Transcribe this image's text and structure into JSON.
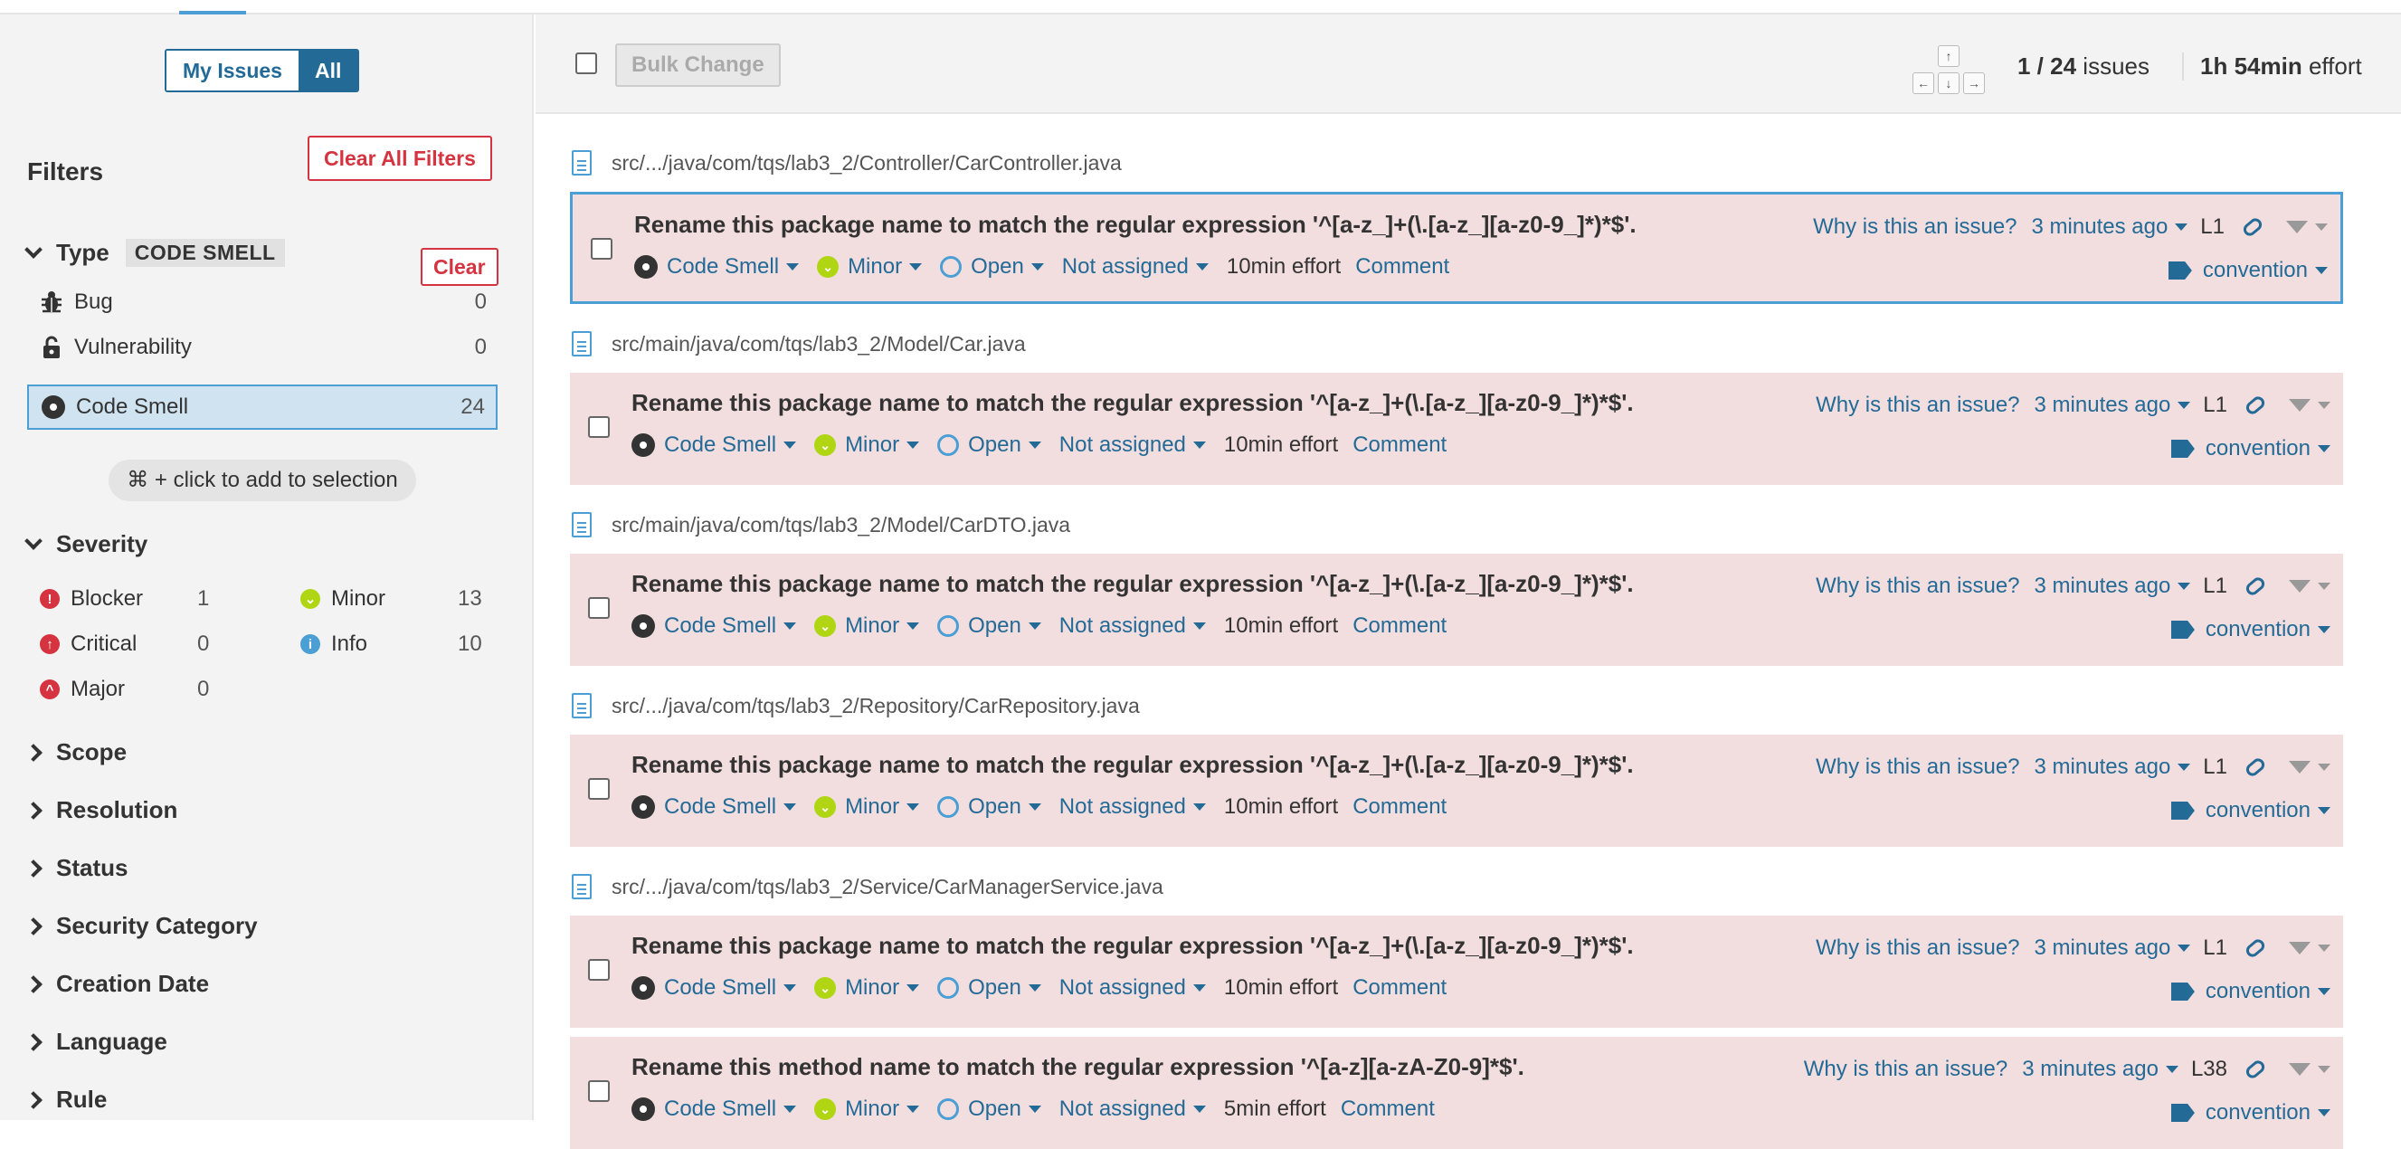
{
  "sidebar": {
    "mode_buttons": [
      "My Issues",
      "All"
    ],
    "filters_title": "Filters",
    "clear_all_label": "Clear All Filters",
    "type_facet": {
      "label": "Type",
      "value": "CODE SMELL",
      "clear_label": "Clear",
      "items": [
        {
          "label": "Bug",
          "count": "0",
          "icon": "bug-icon"
        },
        {
          "label": "Vulnerability",
          "count": "0",
          "icon": "lock-icon"
        },
        {
          "label": "Code Smell",
          "count": "24",
          "icon": "code-smell-icon",
          "selected": true
        }
      ]
    },
    "selection_hint": "⌘ + click to add to selection",
    "severity_facet": {
      "label": "Severity",
      "items": [
        {
          "label": "Blocker",
          "count": "1",
          "icon": "blocker-icon",
          "color": "#d4333f"
        },
        {
          "label": "Minor",
          "count": "13",
          "icon": "minor-icon",
          "color": "#b0d513"
        },
        {
          "label": "Critical",
          "count": "0",
          "icon": "critical-icon",
          "color": "#d4333f"
        },
        {
          "label": "Info",
          "count": "10",
          "icon": "info-icon",
          "color": "#4b9fd5"
        },
        {
          "label": "Major",
          "count": "0",
          "icon": "major-icon",
          "color": "#d4333f"
        }
      ]
    },
    "collapsed_facets": [
      "Scope",
      "Resolution",
      "Status",
      "Security Category",
      "Creation Date",
      "Language",
      "Rule"
    ]
  },
  "toolbar": {
    "bulk_change_label": "Bulk Change",
    "counter_current": "1 / 24",
    "counter_suffix": "issues",
    "effort_value": "1h 54min",
    "effort_suffix": "effort",
    "arrow_keys": [
      "↑",
      "←",
      "↓",
      "→"
    ]
  },
  "issues": [
    {
      "file": "src/.../java/com/tqs/lab3_2/Controller/CarController.java",
      "message": "Rename this package name to match the regular expression '^[a-z_]+(\\.[a-z_][a-z0-9_]*)*$'.",
      "type": "Code Smell",
      "severity": "Minor",
      "status": "Open",
      "assignee": "Not assigned",
      "effort": "10min effort",
      "comment": "Comment",
      "why": "Why is this an issue?",
      "time": "3 minutes ago",
      "line": "L1",
      "tag": "convention",
      "selected": true
    },
    {
      "file": "src/main/java/com/tqs/lab3_2/Model/Car.java",
      "message": "Rename this package name to match the regular expression '^[a-z_]+(\\.[a-z_][a-z0-9_]*)*$'.",
      "type": "Code Smell",
      "severity": "Minor",
      "status": "Open",
      "assignee": "Not assigned",
      "effort": "10min effort",
      "comment": "Comment",
      "why": "Why is this an issue?",
      "time": "3 minutes ago",
      "line": "L1",
      "tag": "convention"
    },
    {
      "file": "src/main/java/com/tqs/lab3_2/Model/CarDTO.java",
      "message": "Rename this package name to match the regular expression '^[a-z_]+(\\.[a-z_][a-z0-9_]*)*$'.",
      "type": "Code Smell",
      "severity": "Minor",
      "status": "Open",
      "assignee": "Not assigned",
      "effort": "10min effort",
      "comment": "Comment",
      "why": "Why is this an issue?",
      "time": "3 minutes ago",
      "line": "L1",
      "tag": "convention"
    },
    {
      "file": "src/.../java/com/tqs/lab3_2/Repository/CarRepository.java",
      "message": "Rename this package name to match the regular expression '^[a-z_]+(\\.[a-z_][a-z0-9_]*)*$'.",
      "type": "Code Smell",
      "severity": "Minor",
      "status": "Open",
      "assignee": "Not assigned",
      "effort": "10min effort",
      "comment": "Comment",
      "why": "Why is this an issue?",
      "time": "3 minutes ago",
      "line": "L1",
      "tag": "convention"
    },
    {
      "file": "src/.../java/com/tqs/lab3_2/Service/CarManagerService.java",
      "message": "Rename this package name to match the regular expression '^[a-z_]+(\\.[a-z_][a-z0-9_]*)*$'.",
      "type": "Code Smell",
      "severity": "Minor",
      "status": "Open",
      "assignee": "Not assigned",
      "effort": "10min effort",
      "comment": "Comment",
      "why": "Why is this an issue?",
      "time": "3 minutes ago",
      "line": "L1",
      "tag": "convention"
    },
    {
      "file": "",
      "message": "Rename this method name to match the regular expression '^[a-z][a-zA-Z0-9]*$'.",
      "type": "Code Smell",
      "severity": "Minor",
      "status": "Open",
      "assignee": "Not assigned",
      "effort": "5min effort",
      "comment": "Comment",
      "why": "Why is this an issue?",
      "time": "3 minutes ago",
      "line": "L38",
      "tag": "convention"
    }
  ]
}
